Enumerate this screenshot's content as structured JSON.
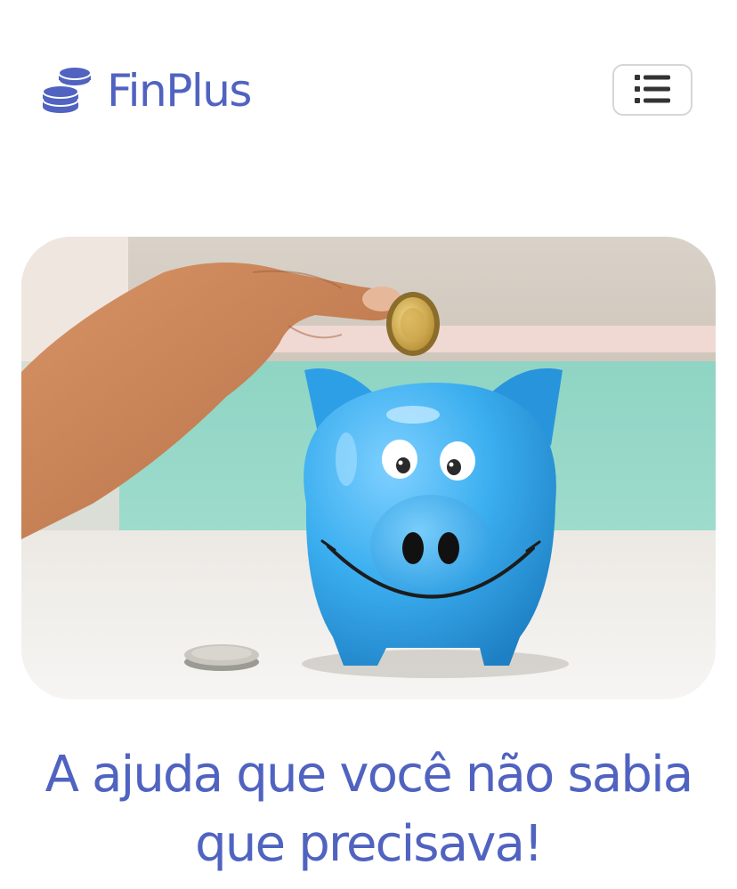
{
  "header": {
    "brand_name": "FinPlus",
    "brand_icon": "coins-icon",
    "menu_icon": "list-icon"
  },
  "hero": {
    "image_subject": "hand dropping coin into blue piggy bank"
  },
  "headline": {
    "line1": "A ajuda que você não sabia",
    "line2": "que precisava!"
  },
  "colors": {
    "brand": "#5063c0",
    "icon_dark": "#333333",
    "button_border": "#d6d6d6"
  }
}
